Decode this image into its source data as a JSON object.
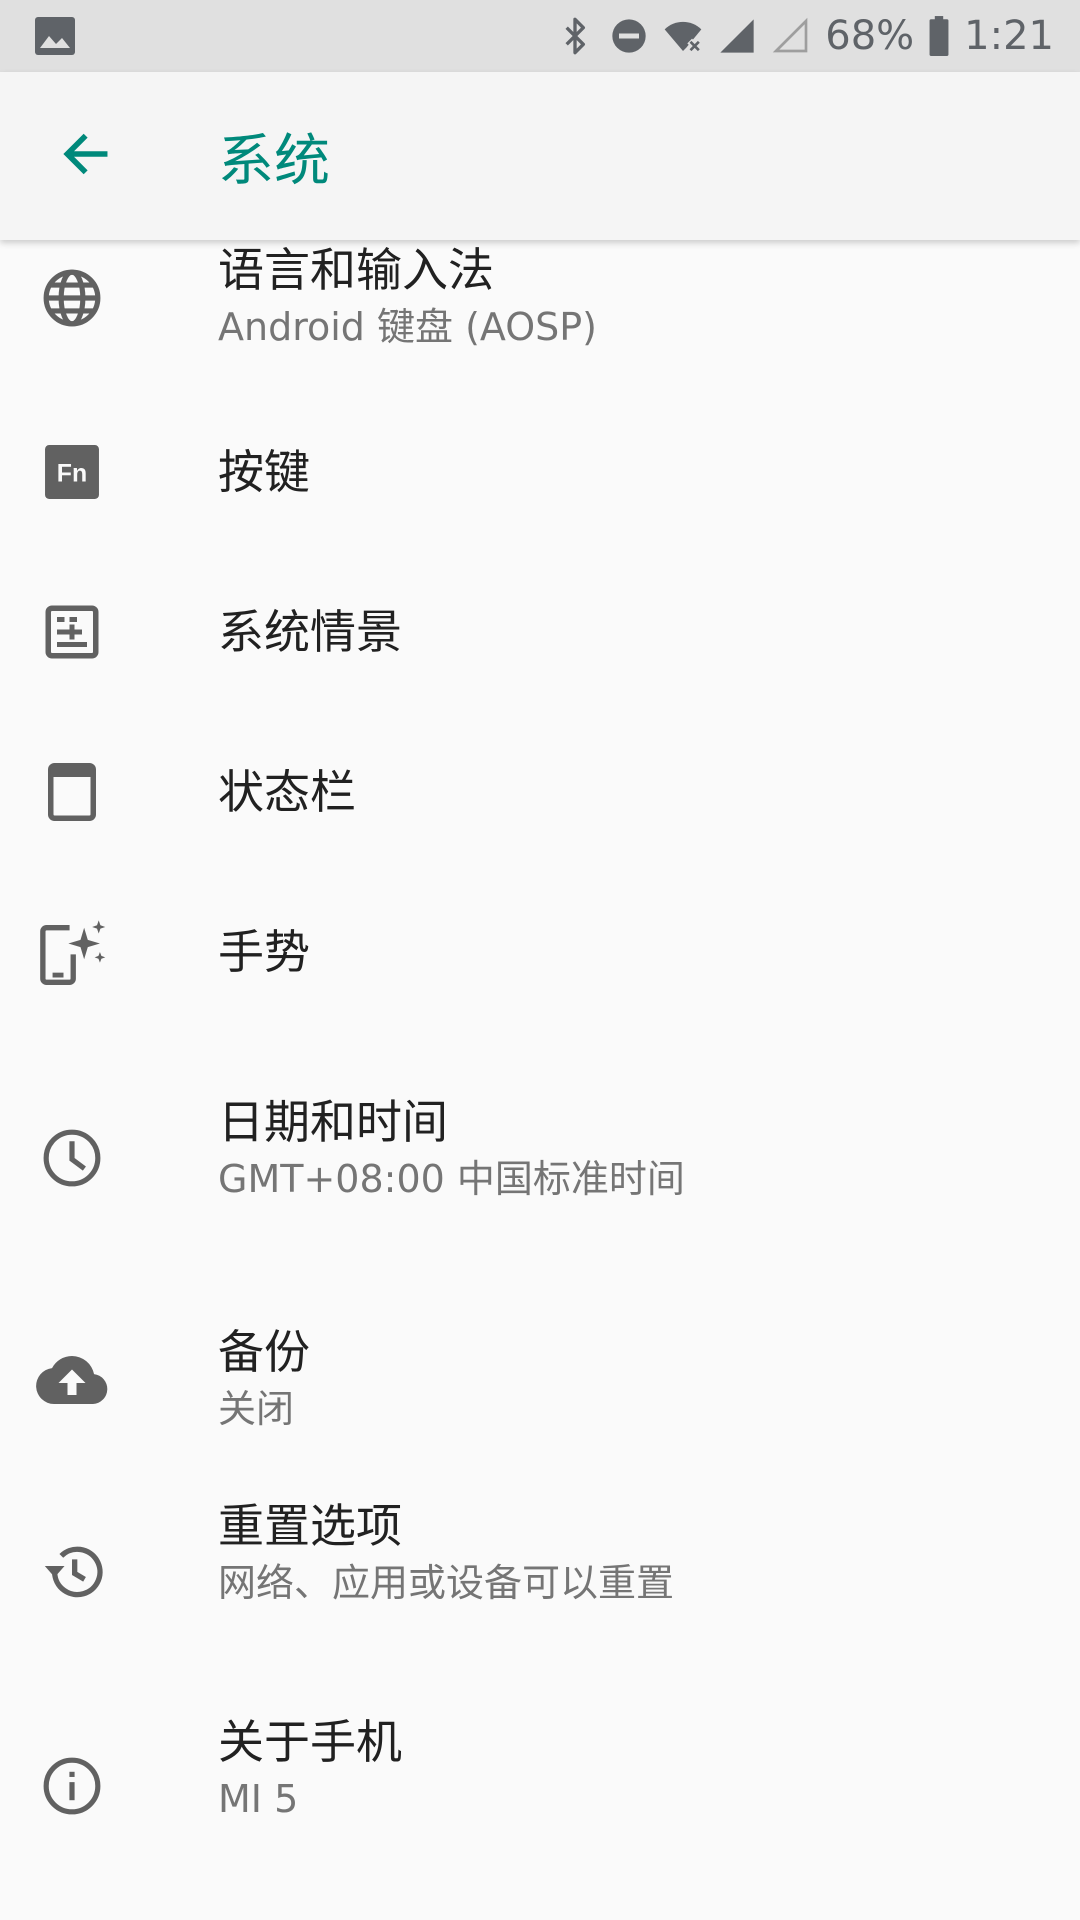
{
  "status_bar": {
    "battery": "68%",
    "time": "1:21"
  },
  "app_bar": {
    "title": "系统"
  },
  "items": [
    {
      "title": "语言和输入法",
      "summary": "Android 键盘 (AOSP)",
      "icon": "globe-icon"
    },
    {
      "title": "按键",
      "icon": "fn-key-icon",
      "icon_text": "Fn"
    },
    {
      "title": "系统情景",
      "icon": "system-scene-icon"
    },
    {
      "title": "状态栏",
      "icon": "status-bar-icon"
    },
    {
      "title": "手势",
      "icon": "gesture-icon"
    },
    {
      "title": "日期和时间",
      "summary": "GMT+08:00 中国标准时间",
      "icon": "clock-icon"
    },
    {
      "title": "备份",
      "summary": "关闭",
      "icon": "cloud-upload-icon"
    },
    {
      "title": "重置选项",
      "summary": "网络、应用或设备可以重置",
      "icon": "restore-icon"
    },
    {
      "title": "关于手机",
      "summary": "MI 5",
      "icon": "info-icon"
    }
  ],
  "colors": {
    "accent": "#00897b",
    "icon": "#616161",
    "title_text": "#212121",
    "summary_text": "#757575"
  }
}
